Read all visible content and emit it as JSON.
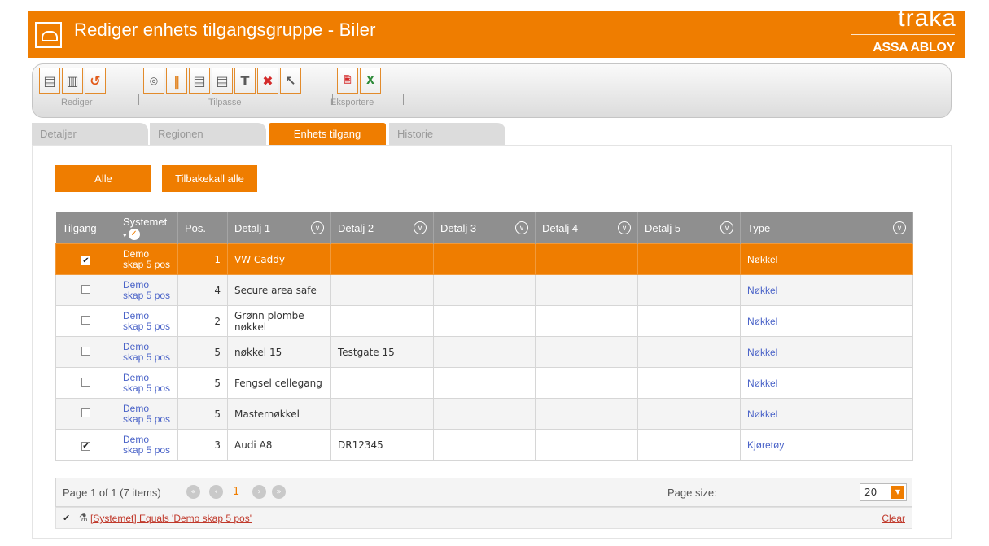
{
  "header": {
    "title": "Rediger enhets tilgangsgruppe - Biler",
    "brand_name": "traka",
    "brand_sub": "ASSA ABLOY"
  },
  "toolbar": {
    "groups": [
      {
        "label": "Rediger",
        "buttons": [
          "save-icon",
          "save-as-icon",
          "undo-icon"
        ]
      },
      {
        "label": "Tilpasse",
        "buttons": [
          "view-icon",
          "columns-icon",
          "save-layout-icon",
          "save-layout-as-icon",
          "text-icon",
          "delete-layout-icon",
          "select-icon"
        ]
      },
      {
        "label": "Eksportere",
        "buttons": [
          "export-pdf-icon",
          "export-excel-icon"
        ]
      }
    ]
  },
  "tabs": [
    {
      "label": "Detaljer",
      "active": false
    },
    {
      "label": "Regionen",
      "active": false
    },
    {
      "label": "Enhets tilgang",
      "active": true
    },
    {
      "label": "Historie",
      "active": false
    }
  ],
  "actions": {
    "all_label": "Alle",
    "revoke_all_label": "Tilbakekall alle"
  },
  "grid": {
    "columns": {
      "access": "Tilgang",
      "system": "Systemet",
      "pos": "Pos.",
      "detail1": "Detalj 1",
      "detail2": "Detalj 2",
      "detail3": "Detalj 3",
      "detail4": "Detalj 4",
      "detail5": "Detalj 5",
      "type": "Type"
    },
    "rows": [
      {
        "access": true,
        "system": "Demo skap 5 pos",
        "pos": "1",
        "detail1": "VW Caddy",
        "detail2": "",
        "type": "Nøkkel",
        "selected": true
      },
      {
        "access": false,
        "system": "Demo skap 5 pos",
        "pos": "4",
        "detail1": "Secure area safe",
        "detail2": "",
        "type": "Nøkkel",
        "selected": false
      },
      {
        "access": false,
        "system": "Demo skap 5 pos",
        "pos": "2",
        "detail1": "Grønn plombe nøkkel",
        "detail2": "",
        "type": "Nøkkel",
        "selected": false
      },
      {
        "access": false,
        "system": "Demo skap 5 pos",
        "pos": "5",
        "detail1": "nøkkel 15",
        "detail2": "Testgate 15",
        "type": "Nøkkel",
        "selected": false
      },
      {
        "access": false,
        "system": "Demo skap 5 pos",
        "pos": "5",
        "detail1": "Fengsel cellegang",
        "detail2": "",
        "type": "Nøkkel",
        "selected": false
      },
      {
        "access": false,
        "system": "Demo skap 5 pos",
        "pos": "5",
        "detail1": "Masternøkkel",
        "detail2": "",
        "type": "Nøkkel",
        "selected": false
      },
      {
        "access": true,
        "system": "Demo skap 5 pos",
        "pos": "3",
        "detail1": "Audi A8",
        "detail2": "DR12345",
        "type": "Kjøretøy",
        "selected": false
      }
    ]
  },
  "pager": {
    "summary": "Page 1 of 1 (7 items)",
    "current_page": "1",
    "page_size_label": "Page size:",
    "page_size": "20"
  },
  "filter": {
    "enabled": true,
    "text": "[Systemet] Equals 'Demo skap 5 pos'",
    "clear_label": "Clear"
  },
  "colors": {
    "accent": "#ef7d00",
    "header_grey": "#8f8f8f",
    "link": "#4a63c8"
  }
}
